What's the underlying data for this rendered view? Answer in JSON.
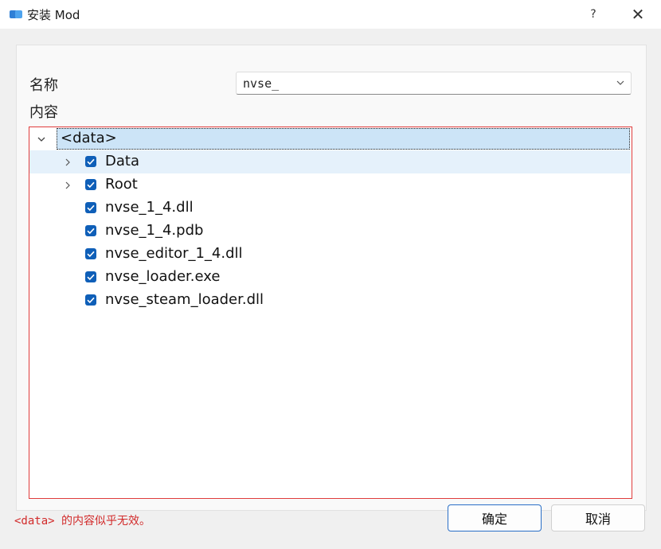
{
  "window": {
    "title": "安装 Mod",
    "help_label": "?",
    "close_label": "✕"
  },
  "form": {
    "name_label": "名称",
    "name_value": "nvse_",
    "content_label": "内容"
  },
  "tree": {
    "root_label": "<data>",
    "items": [
      {
        "label": "Data",
        "expandable": true,
        "checked": true
      },
      {
        "label": "Root",
        "expandable": true,
        "checked": true
      },
      {
        "label": "nvse_1_4.dll",
        "expandable": false,
        "checked": true
      },
      {
        "label": "nvse_1_4.pdb",
        "expandable": false,
        "checked": true
      },
      {
        "label": "nvse_editor_1_4.dll",
        "expandable": false,
        "checked": true
      },
      {
        "label": "nvse_loader.exe",
        "expandable": false,
        "checked": true
      },
      {
        "label": "nvse_steam_loader.dll",
        "expandable": false,
        "checked": true
      }
    ]
  },
  "footer": {
    "error_message": "<data> 的内容似乎无效。",
    "ok_label": "确定",
    "cancel_label": "取消"
  },
  "colors": {
    "accent": "#0f5fb8",
    "error": "#d22b2b",
    "selection": "#cce4f7"
  }
}
